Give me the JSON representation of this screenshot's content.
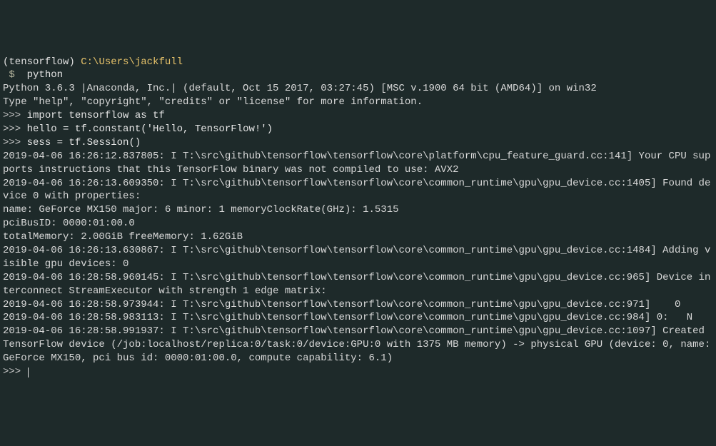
{
  "header": {
    "env": "(tensorflow)",
    "path": "C:\\Users\\jackfull",
    "dollar": "$",
    "command": "python"
  },
  "banner": {
    "line1": "Python 3.6.3 |Anaconda, Inc.| (default, Oct 15 2017, 03:27:45) [MSC v.1900 64 bit (AMD64)] on win32",
    "line2": "Type \"help\", \"copyright\", \"credits\" or \"license\" for more information."
  },
  "repl": {
    "prompt": ">>>",
    "cmd1": "import tensorflow as tf",
    "cmd2": "hello = tf.constant('Hello, TensorFlow!')",
    "cmd3": "sess = tf.Session()"
  },
  "log": {
    "l1": "2019-04-06 16:26:12.837805: I T:\\src\\github\\tensorflow\\tensorflow\\core\\platform\\cpu_feature_guard.cc:141] Your CPU supports instructions that this TensorFlow binary was not compiled to use: AVX2",
    "l2": "2019-04-06 16:26:13.609350: I T:\\src\\github\\tensorflow\\tensorflow\\core\\common_runtime\\gpu\\gpu_device.cc:1405] Found device 0 with properties:",
    "l3": "name: GeForce MX150 major: 6 minor: 1 memoryClockRate(GHz): 1.5315",
    "l4": "pciBusID: 0000:01:00.0",
    "l5": "totalMemory: 2.00GiB freeMemory: 1.62GiB",
    "l6": "2019-04-06 16:26:13.630867: I T:\\src\\github\\tensorflow\\tensorflow\\core\\common_runtime\\gpu\\gpu_device.cc:1484] Adding visible gpu devices: 0",
    "l7": "2019-04-06 16:28:58.960145: I T:\\src\\github\\tensorflow\\tensorflow\\core\\common_runtime\\gpu\\gpu_device.cc:965] Device interconnect StreamExecutor with strength 1 edge matrix:",
    "l8": "2019-04-06 16:28:58.973944: I T:\\src\\github\\tensorflow\\tensorflow\\core\\common_runtime\\gpu\\gpu_device.cc:971]    0",
    "l9": "2019-04-06 16:28:58.983113: I T:\\src\\github\\tensorflow\\tensorflow\\core\\common_runtime\\gpu\\gpu_device.cc:984] 0:   N",
    "l10": "2019-04-06 16:28:58.991937: I T:\\src\\github\\tensorflow\\tensorflow\\core\\common_runtime\\gpu\\gpu_device.cc:1097] Created TensorFlow device (/job:localhost/replica:0/task:0/device:GPU:0 with 1375 MB memory) -> physical GPU (device: 0, name: GeForce MX150, pci bus id: 0000:01:00.0, compute capability: 6.1)"
  },
  "final_prompt": ">>> "
}
